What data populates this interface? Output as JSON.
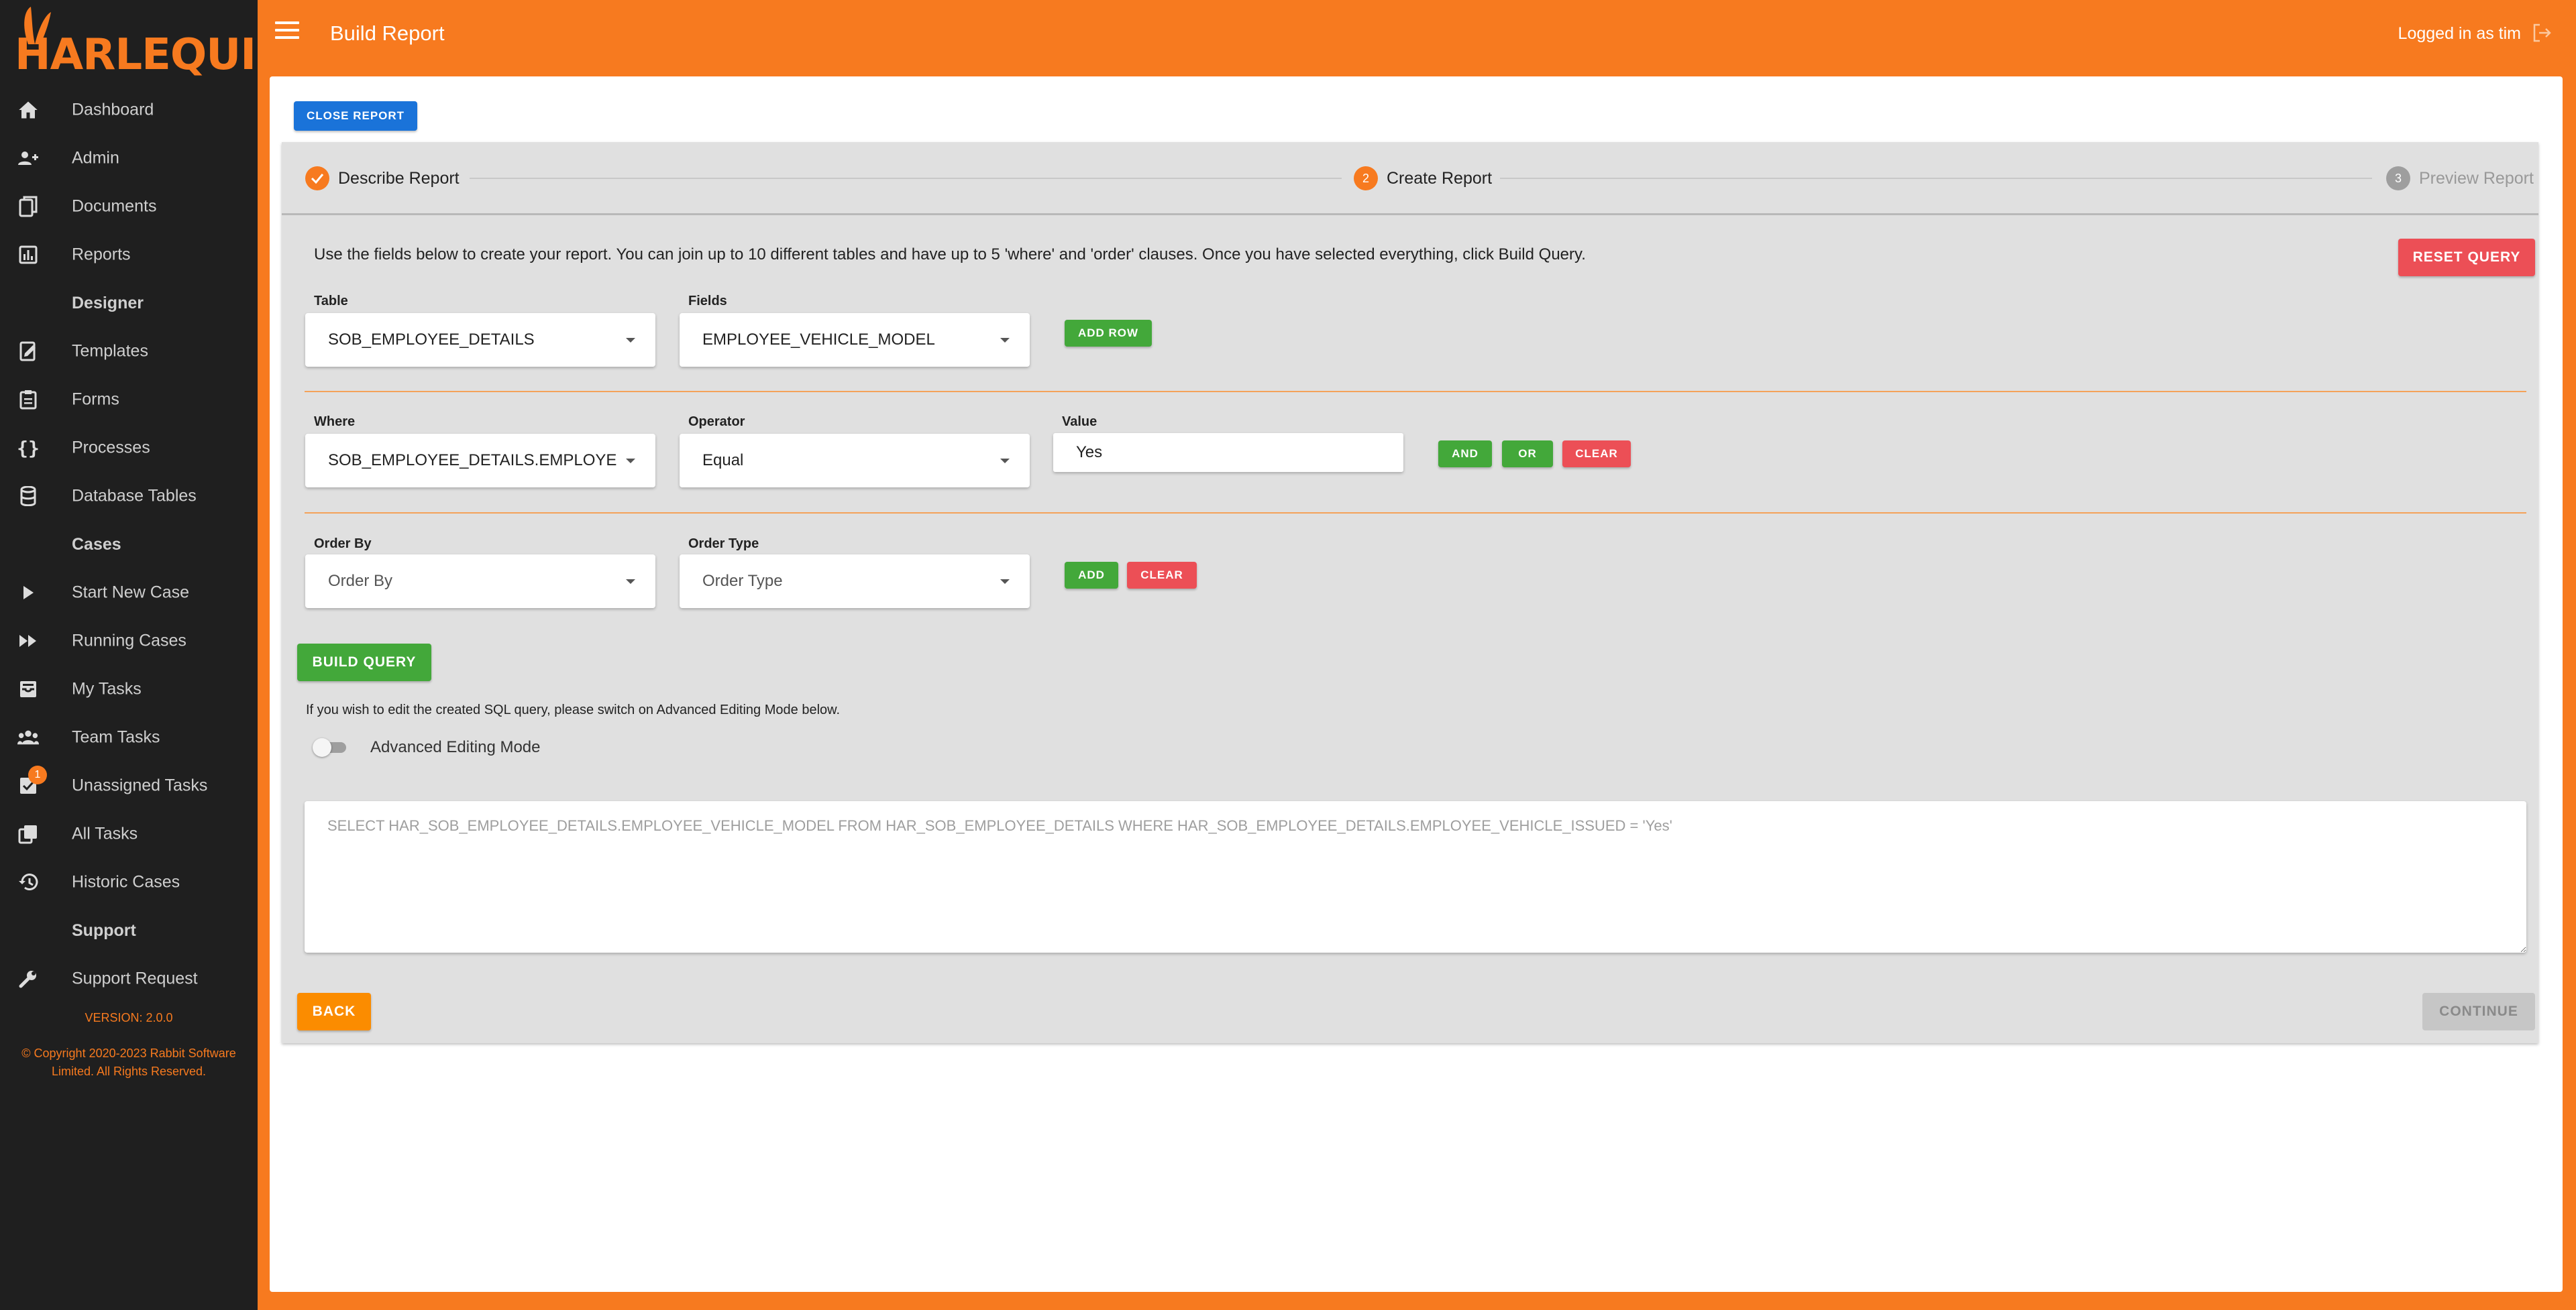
{
  "app": {
    "logo": "HARLEQUIN",
    "brand_color": "#f77a1f"
  },
  "header": {
    "title": "Build Report",
    "user": "Logged in as tim"
  },
  "sidebar": {
    "items": [
      {
        "label": "Dashboard",
        "icon": "home-icon"
      },
      {
        "label": "Admin",
        "icon": "users-icon"
      },
      {
        "label": "Documents",
        "icon": "documents-icon"
      },
      {
        "label": "Reports",
        "icon": "bar-chart-icon"
      }
    ],
    "section_designer": "Designer",
    "designer_items": [
      {
        "label": "Templates",
        "icon": "notebook-icon"
      },
      {
        "label": "Forms",
        "icon": "clipboard-icon"
      },
      {
        "label": "Processes",
        "icon": "braces-icon"
      },
      {
        "label": "Database Tables",
        "icon": "database-icon"
      }
    ],
    "section_cases": "Cases",
    "cases_items": [
      {
        "label": "Start New Case",
        "icon": "play-icon"
      },
      {
        "label": "Running Cases",
        "icon": "fast-forward-icon"
      },
      {
        "label": "My Tasks",
        "icon": "inbox-icon"
      },
      {
        "label": "Team Tasks",
        "icon": "team-icon"
      },
      {
        "label": "Unassigned Tasks",
        "icon": "unassigned-icon",
        "badge": "1"
      },
      {
        "label": "All Tasks",
        "icon": "stack-icon"
      },
      {
        "label": "Historic Cases",
        "icon": "history-icon"
      }
    ],
    "section_support": "Support",
    "support_items": [
      {
        "label": "Support Request",
        "icon": "wrench-icon"
      }
    ],
    "version": "VERSION: 2.0.0",
    "copyright": "© Copyright 2020-2023 Rabbit Software Limited. All Rights Reserved."
  },
  "toolbar": {
    "close_report": "CLOSE REPORT"
  },
  "stepper": {
    "steps": [
      {
        "label": "Describe Report",
        "state": "complete"
      },
      {
        "number": "2",
        "label": "Create Report",
        "state": "active"
      },
      {
        "number": "3",
        "label": "Preview Report",
        "state": "inactive"
      }
    ]
  },
  "form": {
    "info": "Use the fields below to create your report. You can join up to 10 different tables and have up to 5 'where' and 'order' clauses. Once you have selected everything, click Build Query.",
    "reset_query": "RESET QUERY",
    "table_label": "Table",
    "table_value": "SOB_EMPLOYEE_DETAILS",
    "fields_label": "Fields",
    "fields_value": "EMPLOYEE_VEHICLE_MODEL",
    "add_row": "ADD ROW",
    "where_label": "Where",
    "where_value": "SOB_EMPLOYEE_DETAILS.EMPLOYEE_VEHICLE_ISSUED",
    "operator_label": "Operator",
    "operator_value": "Equal",
    "value_label": "Value",
    "value_value": "Yes",
    "and": "AND",
    "or": "OR",
    "clear": "CLEAR",
    "order_by_label": "Order By",
    "order_by_placeholder": "Order By",
    "order_type_label": "Order Type",
    "order_type_placeholder": "Order Type",
    "add": "ADD",
    "clear_order": "CLEAR",
    "build_query": "BUILD QUERY",
    "edit_hint": "If you wish to edit the created SQL query, please switch on Advanced Editing Mode below.",
    "advanced_mode_label": "Advanced Editing Mode",
    "sql": "SELECT HAR_SOB_EMPLOYEE_DETAILS.EMPLOYEE_VEHICLE_MODEL FROM HAR_SOB_EMPLOYEE_DETAILS WHERE HAR_SOB_EMPLOYEE_DETAILS.EMPLOYEE_VEHICLE_ISSUED = 'Yes'",
    "back": "BACK",
    "continue": "CONTINUE"
  },
  "colors": {
    "sidebar_bg": "#1f1f1f",
    "panel_bg": "#e0e0e0",
    "primary_blue": "#1a73d9",
    "green": "#43a83a",
    "red": "#ec4f56",
    "orange_button": "#fb8c00"
  }
}
